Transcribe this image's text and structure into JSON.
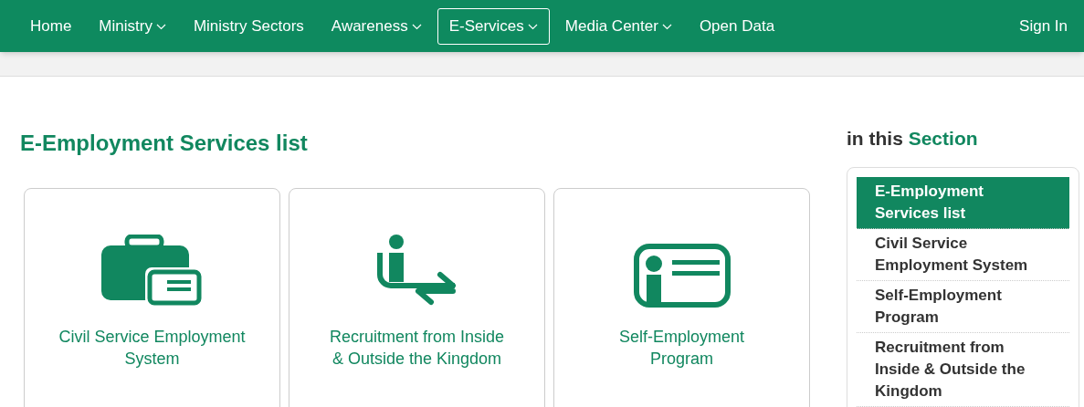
{
  "nav": {
    "items": [
      {
        "label": "Home",
        "dropdown": false,
        "selected": false
      },
      {
        "label": "Ministry",
        "dropdown": true,
        "selected": false
      },
      {
        "label": "Ministry Sectors",
        "dropdown": false,
        "selected": false
      },
      {
        "label": "Awareness",
        "dropdown": true,
        "selected": false
      },
      {
        "label": "E-Services",
        "dropdown": true,
        "selected": true
      },
      {
        "label": "Media Center",
        "dropdown": true,
        "selected": false
      },
      {
        "label": "Open Data",
        "dropdown": false,
        "selected": false
      }
    ],
    "sign_in": "Sign In"
  },
  "main": {
    "title": "E-Employment Services list",
    "cards": [
      {
        "kind": "briefcase",
        "label": "Civil Service Employment System"
      },
      {
        "kind": "transfer",
        "label": "Recruitment from Inside & Outside the Kingdom"
      },
      {
        "kind": "id-card",
        "label": "Self-Employment Program"
      }
    ]
  },
  "sidebar": {
    "heading": "in this",
    "heading_highlight": "Section",
    "items": [
      {
        "label": "E-Employment Services list",
        "selected": true
      },
      {
        "label": "Civil Service Employment System",
        "selected": false
      },
      {
        "label": "Self-Employment Program",
        "selected": false
      },
      {
        "label": "Recruitment from Inside & Outside the Kingdom",
        "selected": false
      }
    ]
  }
}
